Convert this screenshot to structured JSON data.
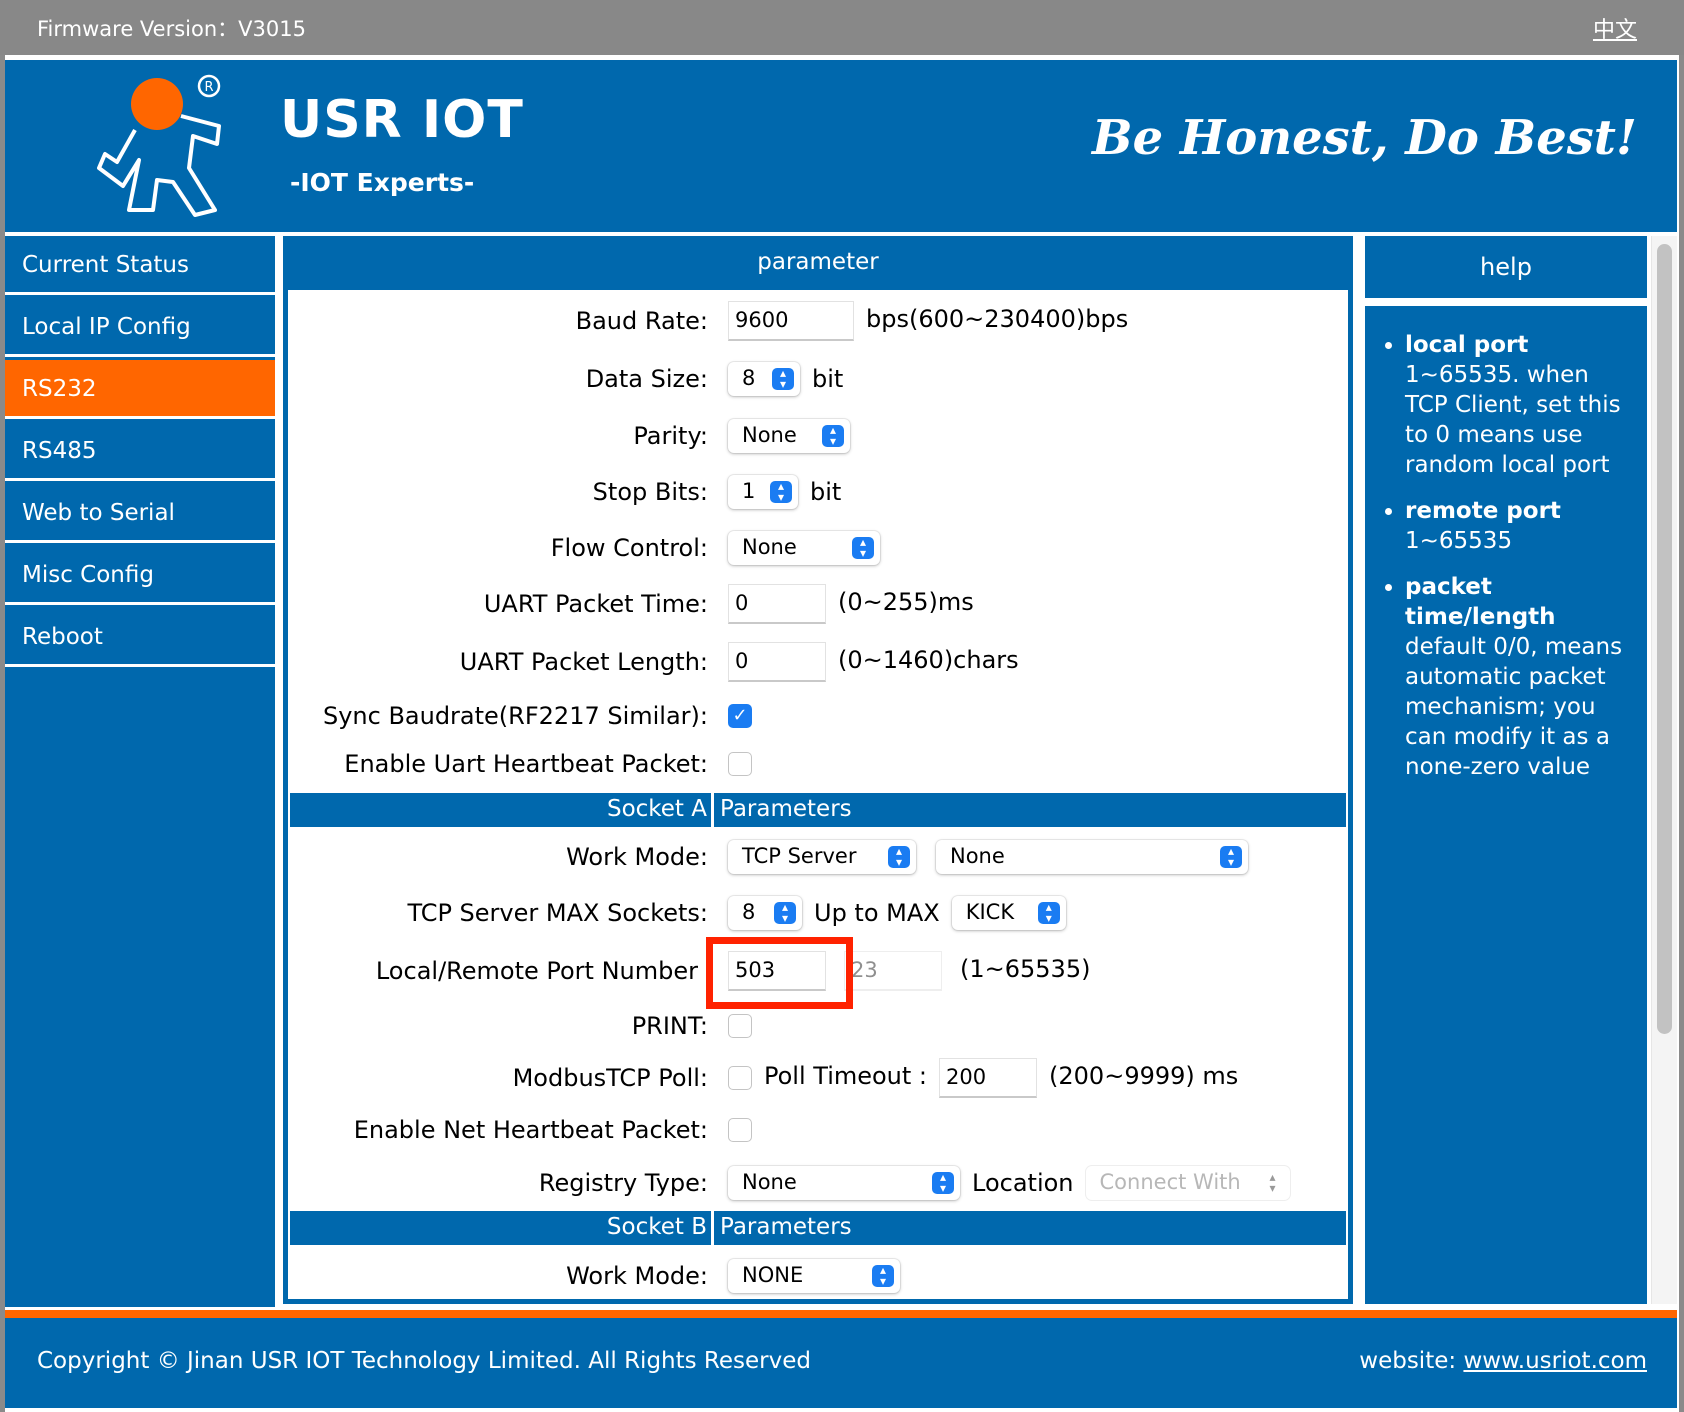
{
  "topbar": {
    "firmware_label": "Firmware Version：V3015",
    "language_link": "中文"
  },
  "header": {
    "brand": "USR IOT",
    "subtitle": "-IOT Experts-",
    "motto": "Be Honest, Do Best!",
    "logo_icon": "running-man-logo-icon"
  },
  "sidebar": {
    "items": [
      {
        "label": "Current Status",
        "active": false
      },
      {
        "label": "Local IP Config",
        "active": false
      },
      {
        "label": "RS232",
        "active": true
      },
      {
        "label": "RS485",
        "active": false
      },
      {
        "label": "Web to Serial",
        "active": false
      },
      {
        "label": "Misc Config",
        "active": false
      },
      {
        "label": "Reboot",
        "active": false
      }
    ]
  },
  "param": {
    "title": "parameter",
    "baud_rate": {
      "label": "Baud Rate:",
      "value": "9600",
      "suffix": "bps(600~230400)bps"
    },
    "data_size": {
      "label": "Data Size:",
      "value": "8",
      "suffix": "bit"
    },
    "parity": {
      "label": "Parity:",
      "value": "None"
    },
    "stop_bits": {
      "label": "Stop Bits:",
      "value": "1",
      "suffix": "bit"
    },
    "flow_control": {
      "label": "Flow Control:",
      "value": "None"
    },
    "uart_packet_time": {
      "label": "UART Packet Time:",
      "value": "0",
      "suffix": "(0~255)ms"
    },
    "uart_packet_length": {
      "label": "UART Packet Length:",
      "value": "0",
      "suffix": "(0~1460)chars"
    },
    "sync_baudrate": {
      "label": "Sync Baudrate(RF2217 Similar):",
      "checked": true
    },
    "uart_heartbeat": {
      "label": "Enable Uart Heartbeat Packet:",
      "checked": false
    },
    "socket_a": {
      "section_left": "Socket A",
      "section_right": "Parameters",
      "work_mode": {
        "label": "Work Mode:",
        "value": "TCP Server",
        "secondary_value": "None"
      },
      "max_sockets": {
        "label": "TCP Server MAX Sockets:",
        "value": "8",
        "up_to_label": "Up to MAX",
        "up_to_value": "KICK"
      },
      "port": {
        "label": "Local/Remote Port Number",
        "local_value": "503",
        "remote_value": "23",
        "suffix": "(1~65535)"
      },
      "print": {
        "label": "PRINT:",
        "checked": false
      },
      "modbus_poll": {
        "label": "ModbusTCP Poll:",
        "checked": false,
        "timeout_label": "Poll Timeout :",
        "timeout_value": "200",
        "timeout_suffix": "(200~9999) ms"
      },
      "net_heartbeat": {
        "label": "Enable Net Heartbeat Packet:",
        "checked": false
      },
      "registry": {
        "label": "Registry Type:",
        "value": "None",
        "location_label": "Location",
        "location_value": "Connect With"
      }
    },
    "socket_b": {
      "section_left": "Socket B",
      "section_right": "Parameters",
      "work_mode": {
        "label": "Work Mode:",
        "value": "NONE"
      }
    }
  },
  "help": {
    "title": "help",
    "items": [
      {
        "term": "local port",
        "text": "1~65535. when TCP Client, set this to 0 means use random local port"
      },
      {
        "term": "remote port",
        "text": "1~65535"
      },
      {
        "term": "packet time/length",
        "text": "default 0/0, means automatic packet mechanism; you can modify it as a none-zero value"
      }
    ]
  },
  "footer": {
    "copyright": "Copyright © Jinan USR IOT Technology Limited. All Rights Reserved",
    "website_label": "website:",
    "website_link": "www.usriot.com"
  },
  "colors": {
    "brand_blue": "#0068ad",
    "accent_orange": "#ff6600",
    "topbar_gray": "#888888",
    "highlight_red": "#ff2200",
    "select_blue": "#1a7cf2"
  }
}
